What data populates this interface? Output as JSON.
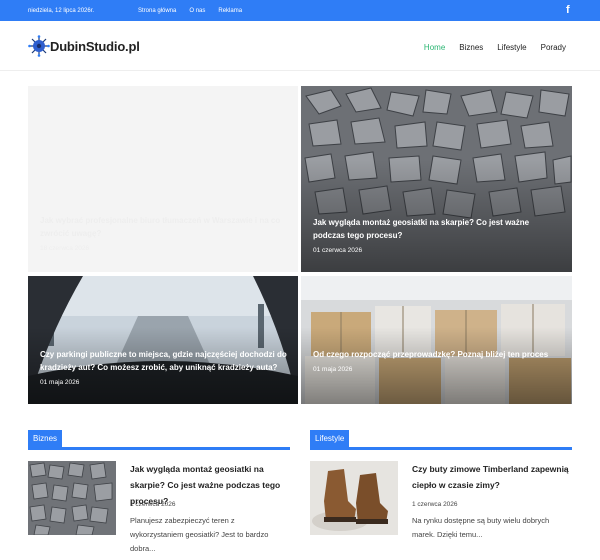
{
  "topbar": {
    "date": "niedziela, 12 lipca 2026r.",
    "links": [
      "Strona główna",
      "O nas",
      "Reklama"
    ],
    "social_icon": "facebook-icon",
    "color": "#2f7df6"
  },
  "header": {
    "logo_text": "DubinStudio.pl",
    "nav": [
      "Home",
      "Biznes",
      "Lifestyle",
      "Porady"
    ],
    "active_color": "#2bb673"
  },
  "featured": [
    {
      "title": "Jak wybrać profesjonalne biuro tłumaczeń w Warszawie i na co zwrócić uwagę?",
      "date": "18 czerwca 2026"
    },
    {
      "title": "Jak wygląda montaż geosiatki na skarpie? Co jest ważne podczas tego procesu?",
      "date": "01 czerwca 2026"
    },
    {
      "title": "Czy parkingi publiczne to miejsca, gdzie najczęściej dochodzi do kradzieży aut? Co możesz zrobić, aby uniknąć kradzieży auta?",
      "date": "01 maja 2026"
    },
    {
      "title": "Od czego rozpocząć przeprowadzkę? Poznaj bliżej ten proces",
      "date": "01 maja 2026"
    }
  ],
  "sections": [
    {
      "label": "Biznes",
      "post": {
        "title": "Jak wygląda montaż geosiatki na skarpie? Co jest ważne podczas tego procesu?",
        "date": "1 czerwca 2026",
        "excerpt": "Planujesz zabezpieczyć teren z wykorzystaniem geosiatki? Jest to bardzo dobra..."
      }
    },
    {
      "label": "Lifestyle",
      "post": {
        "title": "Czy buty zimowe Timberland zapewnią ciepło w czasie zimy?",
        "date": "1 czerwca 2026",
        "excerpt": "Na rynku dostępne są buty wielu dobrych marek. Dzięki temu..."
      }
    }
  ]
}
